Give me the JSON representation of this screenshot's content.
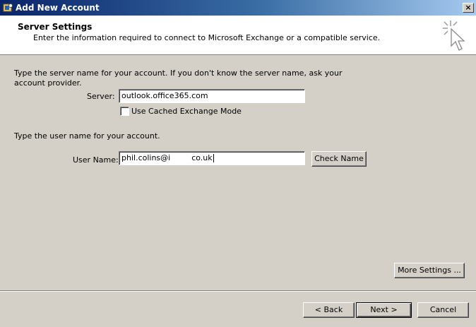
{
  "window": {
    "title": "Add New Account",
    "close_label": "×"
  },
  "header": {
    "title": "Server Settings",
    "subtitle": "Enter the information required to connect to Microsoft Exchange or a compatible service."
  },
  "server_section": {
    "instructions_line1": "Type the server name for your account. If you don't know the server name, ask your",
    "instructions_line2": "account provider.",
    "server_label": "Server:",
    "server_value": "outlook.office365.com",
    "cached_mode_label": "Use Cached Exchange Mode",
    "cached_mode_checked": false
  },
  "user_section": {
    "instructions": "Type the user name for your account.",
    "username_label": "User Name:",
    "username_value_start": "phil.colins@i",
    "username_value_end": "co.uk",
    "check_name_label": "Check Name"
  },
  "buttons": {
    "more_settings": "More Settings ...",
    "back": "< Back",
    "next": "Next >",
    "cancel": "Cancel"
  }
}
